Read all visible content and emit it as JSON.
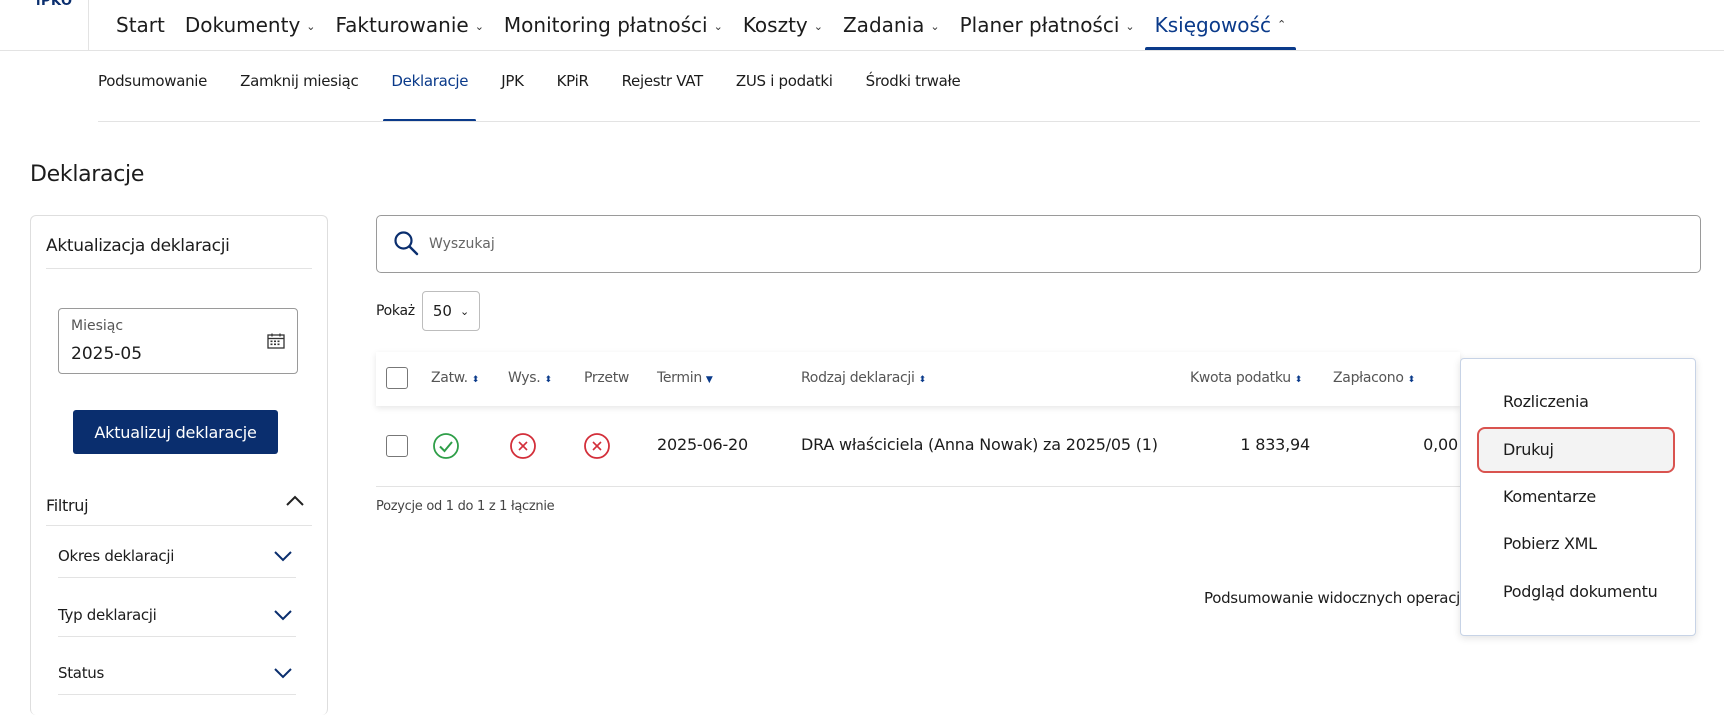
{
  "brand": {
    "logo_text": "iPKO"
  },
  "topnav": {
    "items": [
      {
        "label": "Start",
        "has_chevron": false
      },
      {
        "label": "Dokumenty",
        "has_chevron": true
      },
      {
        "label": "Fakturowanie",
        "has_chevron": true
      },
      {
        "label": "Monitoring płatności",
        "has_chevron": true
      },
      {
        "label": "Koszty",
        "has_chevron": true
      },
      {
        "label": "Zadania",
        "has_chevron": true
      },
      {
        "label": "Planer płatności",
        "has_chevron": true
      },
      {
        "label": "Księgowość",
        "has_chevron": true,
        "active": true
      }
    ]
  },
  "subnav": {
    "items": [
      {
        "label": "Podsumowanie"
      },
      {
        "label": "Zamknij miesiąc"
      },
      {
        "label": "Deklaracje",
        "active": true
      },
      {
        "label": "JPK"
      },
      {
        "label": "KPiR"
      },
      {
        "label": "Rejestr VAT"
      },
      {
        "label": "ZUS i podatki"
      },
      {
        "label": "Środki trwałe"
      }
    ]
  },
  "page": {
    "title": "Deklaracje"
  },
  "sidebar": {
    "title": "Aktualizacja deklaracji",
    "month_label": "Miesiąc",
    "month_value": "2025-05",
    "update_button": "Aktualizuj deklaracje",
    "filter_label": "Filtruj",
    "filters": [
      {
        "label": "Okres deklaracji"
      },
      {
        "label": "Typ deklaracji"
      },
      {
        "label": "Status"
      }
    ]
  },
  "search": {
    "placeholder": "Wyszukaj"
  },
  "pagination": {
    "show_label": "Pokaż",
    "page_size": "50"
  },
  "table": {
    "headers": {
      "approved": "Zatw.",
      "sent": "Wys.",
      "processed": "Przetw",
      "due": "Termin",
      "type": "Rodzaj deklaracji",
      "tax_amount": "Kwota podatku",
      "paid": "Zapłacono"
    },
    "rows": [
      {
        "approved": "ok",
        "sent": "error",
        "processed": "error",
        "due": "2025-06-20",
        "type": "DRA właściciela (Anna Nowak) za 2025/05 (1)",
        "tax_amount": "1 833,94",
        "paid": "0,00"
      }
    ],
    "positions_text": "Pozycje od 1 do 1 z 1 łącznie",
    "summary_text": "Podsumowanie widocznych operacji"
  },
  "context_menu": {
    "items": [
      {
        "label": "Rozliczenia"
      },
      {
        "label": "Drukuj",
        "highlighted": true
      },
      {
        "label": "Komentarze"
      },
      {
        "label": "Pobierz XML"
      },
      {
        "label": "Podgląd dokumentu"
      }
    ]
  },
  "colors": {
    "brand_navy": "#0a2e6e",
    "accent_blue": "#0a3a8a",
    "success_green": "#2e9e48",
    "error_red": "#d32f3a",
    "highlight_red": "#d9534f"
  },
  "icons": {
    "calendar": "calendar-icon",
    "search": "search-icon",
    "chevron_up": "chevron-up-icon",
    "chevron_down": "chevron-down-icon",
    "check_circle": "check-circle-icon",
    "x_circle": "x-circle-icon",
    "sort": "sort-icon"
  }
}
